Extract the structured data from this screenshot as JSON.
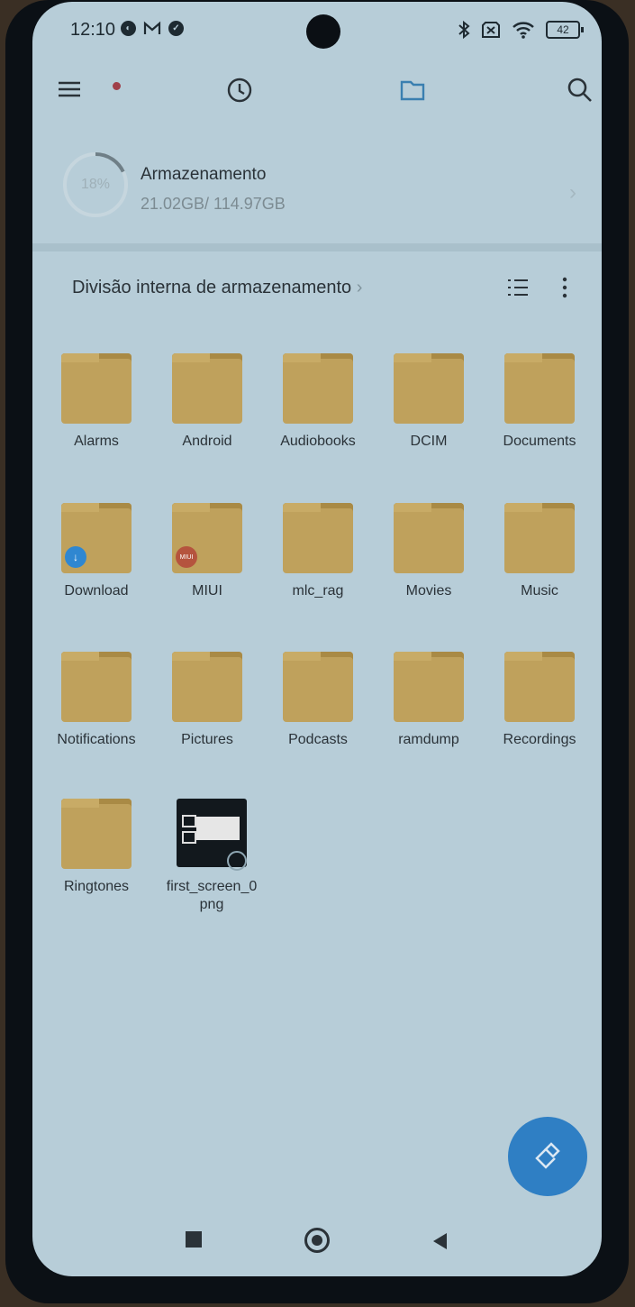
{
  "status_bar": {
    "time": "12:10",
    "battery_level": "42",
    "icons": [
      "theme-icon",
      "gmail-icon",
      "check-icon",
      "bluetooth-icon",
      "sim-blocked-icon",
      "wifi-icon",
      "battery-icon"
    ]
  },
  "toolbar": {
    "icons": [
      "menu-icon",
      "clock-icon",
      "folder-icon",
      "search-icon"
    ],
    "notification_dot_color": "#a0404a"
  },
  "storage": {
    "percent_label": "18%",
    "percent_used": 18,
    "title": "Armazenamento",
    "size": "21.02GB/ 114.97GB"
  },
  "breadcrumb": {
    "title": "Divisão interna de armazenamento",
    "chevron": "›"
  },
  "folders": [
    {
      "name": "Alarms"
    },
    {
      "name": "Android"
    },
    {
      "name": "Audiobooks"
    },
    {
      "name": "DCIM"
    },
    {
      "name": "Documents"
    },
    {
      "name": "Download",
      "badge": "download-icon"
    },
    {
      "name": "MIUI",
      "badge": "miui-icon"
    },
    {
      "name": "mlc_rag"
    },
    {
      "name": "Movies"
    },
    {
      "name": "Music"
    },
    {
      "name": "Notifications"
    },
    {
      "name": "Pictures"
    },
    {
      "name": "Podcasts"
    },
    {
      "name": "ramdump"
    },
    {
      "name": "Recordings"
    },
    {
      "name": "Ringtones"
    }
  ],
  "file": {
    "name": "first_screen_0.png",
    "label_line1": "first_screen_0",
    "label_line2": "png"
  },
  "fab": {
    "icon": "clean-broom-icon",
    "color": "#2f7fc4"
  },
  "navbar": {
    "icons": [
      "recents-icon",
      "home-icon",
      "back-icon"
    ]
  }
}
